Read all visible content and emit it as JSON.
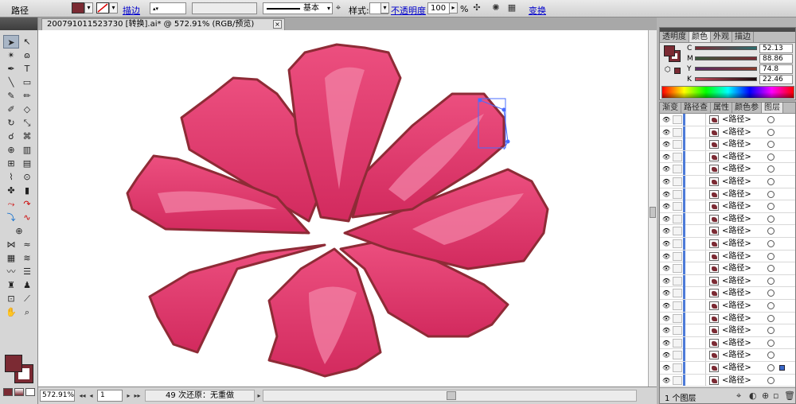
{
  "control_bar": {
    "selection_type": "路径",
    "stroke_link": "描边",
    "style_label": "基本",
    "style_link_label": "样式:",
    "opacity_link": "不透明度",
    "opacity_value": "100",
    "opacity_unit": "%",
    "transform_link": "变换"
  },
  "document": {
    "tab_title": "200791011523730 [转换].ai* @ 572.91% (RGB/预览)",
    "close_glyph": "×"
  },
  "status_bar": {
    "zoom": "572.91%",
    "page": "1",
    "undo_info": "49 次还原：无重做"
  },
  "color_panel": {
    "tabs": [
      "透明度",
      "颜色",
      "外观",
      "描边"
    ],
    "active_tab": 1,
    "channels": [
      {
        "label": "C",
        "value": "52.13"
      },
      {
        "label": "M",
        "value": "88.86"
      },
      {
        "label": "Y",
        "value": "74.8"
      },
      {
        "label": "K",
        "value": "22.46"
      }
    ]
  },
  "layers_panel": {
    "tabs": [
      "渐变",
      "路径查",
      "属性",
      "颜色参",
      "图层"
    ],
    "active_tab": 4,
    "items": [
      "<路径>",
      "<路径>",
      "<路径>",
      "<路径>",
      "<路径>",
      "<路径>",
      "<路径>",
      "<路径>",
      "<路径>",
      "<路径>",
      "<路径>",
      "<路径>",
      "<路径>",
      "<路径>",
      "<路径>",
      "<路径>",
      "<路径>",
      "<路径>",
      "<路径>",
      "<路径>",
      "<路径>",
      "<路径>"
    ],
    "footer_count": "1 个图层"
  },
  "colors": {
    "fill": "#7b2a33",
    "petal": "#e0376a",
    "petal_highlight": "#ee6b95",
    "petal_outline": "#8e2b36",
    "selection": "#4a6cff"
  }
}
